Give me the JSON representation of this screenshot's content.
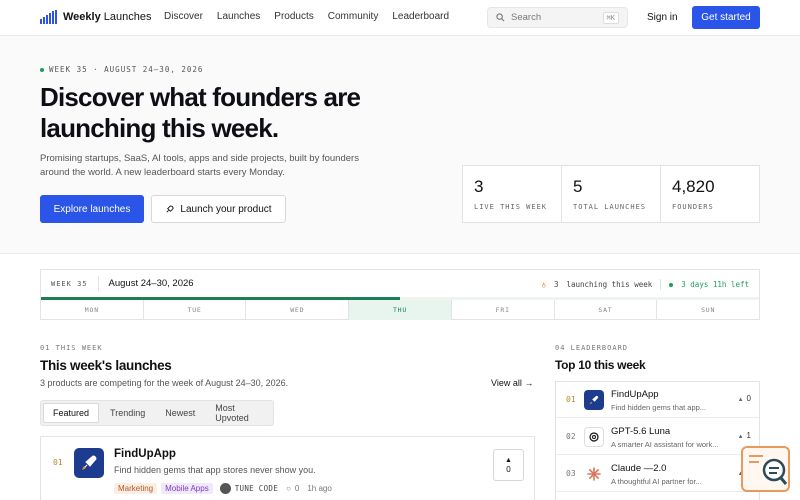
{
  "nav": {
    "logo_bold": "Weekly",
    "logo_light": "Launches",
    "links": [
      "Discover",
      "Launches",
      "Products",
      "Community",
      "Leaderboard"
    ],
    "search_placeholder": "Search",
    "search_shortcut": "⌘K",
    "sign_in": "Sign in",
    "get_started": "Get started",
    "accent": "#2a55e8"
  },
  "hero": {
    "eyebrow": "WEEK 35 · AUGUST 24–30, 2026",
    "title": "Discover what founders are launching this week.",
    "subtitle": "Promising startups, SaaS, AI tools, apps and side projects, built by founders around the world. A new leaderboard starts every Monday.",
    "explore_label": "Explore launches",
    "launch_label": "Launch your product",
    "stats": [
      {
        "value": "3",
        "label": "LIVE THIS WEEK"
      },
      {
        "value": "5",
        "label": "TOTAL LAUNCHES"
      },
      {
        "value": "4,820",
        "label": "FOUNDERS"
      }
    ]
  },
  "weekbar": {
    "tag": "WEEK 35",
    "dates": "August 24–30, 2026",
    "launching_count": "3",
    "launching_text": "launching this week",
    "time_left": "3 days 11h left",
    "progress": 0.5,
    "days": [
      "MON",
      "TUE",
      "WED",
      "THU",
      "FRI",
      "SAT",
      "SUN"
    ],
    "today_index": 3
  },
  "launches": {
    "eyebrow": "01   THIS WEEK",
    "title": "This week's launches",
    "subtitle": "3 products are competing for the week of August 24–30, 2026.",
    "view_all": "View all →",
    "tabs": [
      "Featured",
      "Trending",
      "Newest",
      "Most Upvoted"
    ],
    "active_tab": 0,
    "items": [
      {
        "rank": "01",
        "name": "FindUpApp",
        "description": "Find hidden gems that app stores never show you.",
        "tags": [
          "Marketing",
          "Mobile Apps"
        ],
        "maker": "TUNE CODE",
        "comments": "0",
        "time": "1h ago",
        "votes": "0"
      }
    ]
  },
  "leaderboard": {
    "eyebrow": "04   LEADERBOARD",
    "title": "Top 10 this week",
    "items": [
      {
        "rank": "01",
        "name": "FindUpApp",
        "description": "Find hidden gems that app...",
        "votes": "0"
      },
      {
        "rank": "02",
        "name": "GPT-5.6 Luna",
        "description": "A smarter AI assistant for work...",
        "votes": "1"
      },
      {
        "rank": "03",
        "name": "Claude —2.0",
        "description": "A thoughtful AI partner for...",
        "votes": "0"
      }
    ]
  }
}
